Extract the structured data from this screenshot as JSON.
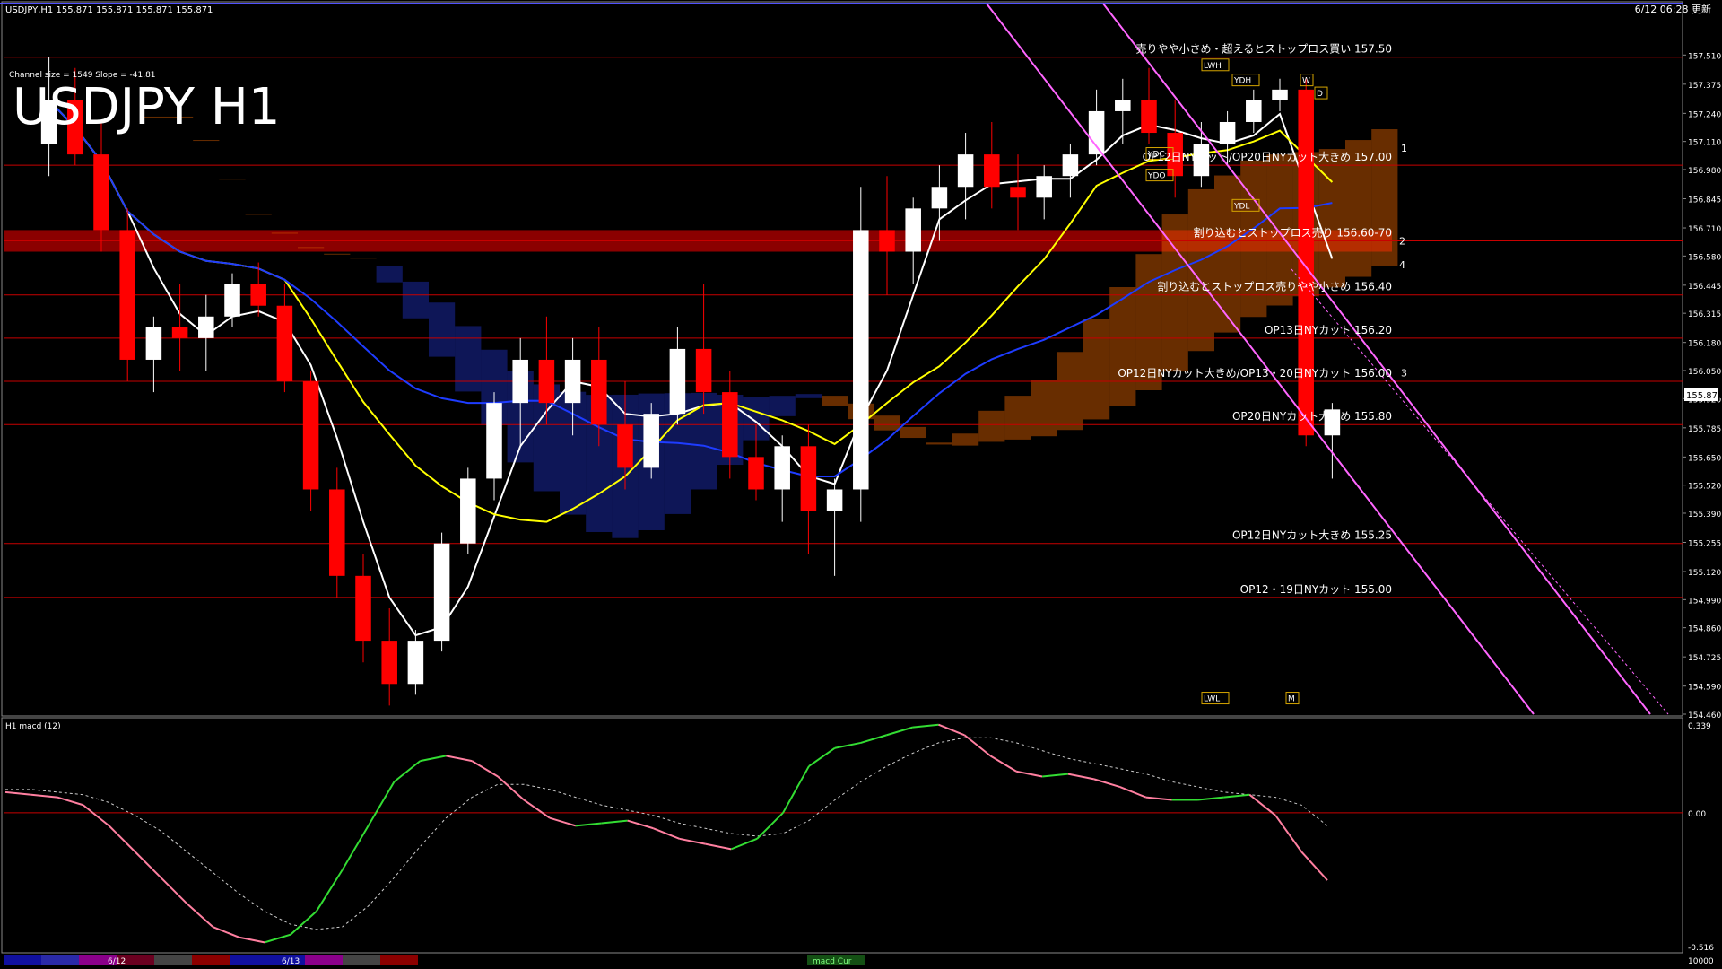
{
  "window": {
    "symbol_info": "USDJPY,H1  155.871 155.871 155.871 155.871",
    "timestamp": "6/12 06:28 更新",
    "channel_info": "Channel size = 1549 Slope = -41.81",
    "big_title": "USDJPY H1",
    "price_label": "155.871"
  },
  "colors": {
    "background": "#000000",
    "bull_candle": "#ffffff",
    "bear_candle": "#ff0000",
    "level_line": "#c80000",
    "resistance_band": "#8b0000",
    "macd_line": "#ff7fa0",
    "macd_up": "#33dd33",
    "macd_signal": "#cccccc",
    "ma_white": "#ffffff",
    "ma_yellow": "#ffff00",
    "ma_blue": "#1e3cff",
    "channel_line": "#ff66ff",
    "cloud": "#e66400"
  },
  "chart_data": [
    {
      "type": "candlestick",
      "title": "USDJPY H1",
      "ylim": [
        154.46,
        157.64
      ],
      "yticks": [
        "157.510",
        "157.375",
        "157.240",
        "157.110",
        "156.980",
        "156.845",
        "156.710",
        "156.580",
        "156.445",
        "156.315",
        "156.180",
        "156.050",
        "155.920",
        "155.785",
        "155.650",
        "155.520",
        "155.390",
        "155.255",
        "155.120",
        "154.990",
        "154.860",
        "154.725",
        "154.590",
        "154.460"
      ],
      "current_price": 155.871,
      "levels": [
        {
          "price": 157.5,
          "label": "売りやや小さめ・超えるとストップロス買い 157.50"
        },
        {
          "price": 157.0,
          "label": "OP12日NYカット/OP20日NYカット大きめ 157.00"
        },
        {
          "price": 156.65,
          "label": "割り込むとストップロス売り 156.60-70"
        },
        {
          "price": 156.4,
          "label": "割り込むとストップロス売りやや小さめ 156.40"
        },
        {
          "price": 156.2,
          "label": "OP13日NYカット 156.20"
        },
        {
          "price": 156.0,
          "label": "OP12日NYカット大きめ/OP13・20日NYカット 156.00"
        },
        {
          "price": 155.8,
          "label": "OP20日NYカット大きめ 155.80"
        },
        {
          "price": 155.25,
          "label": "OP12日NYカット大きめ 155.25"
        },
        {
          "price": 155.0,
          "label": "OP12・19日NYカット 155.00"
        }
      ],
      "channel_numbers": [
        "1",
        "2",
        "3",
        "4"
      ],
      "markers": [
        "LWH",
        "YDH",
        "YDL",
        "YDC",
        "YDO",
        "W",
        "D",
        "LWL",
        "M"
      ],
      "candles": [
        {
          "o": 157.1,
          "h": 157.5,
          "l": 156.95,
          "c": 157.3
        },
        {
          "o": 157.3,
          "h": 157.45,
          "l": 157.0,
          "c": 157.05
        },
        {
          "o": 157.05,
          "h": 157.2,
          "l": 156.6,
          "c": 156.7
        },
        {
          "o": 156.7,
          "h": 156.8,
          "l": 156.0,
          "c": 156.1
        },
        {
          "o": 156.1,
          "h": 156.3,
          "l": 155.95,
          "c": 156.25
        },
        {
          "o": 156.25,
          "h": 156.45,
          "l": 156.05,
          "c": 156.2
        },
        {
          "o": 156.2,
          "h": 156.4,
          "l": 156.05,
          "c": 156.3
        },
        {
          "o": 156.3,
          "h": 156.5,
          "l": 156.25,
          "c": 156.45
        },
        {
          "o": 156.45,
          "h": 156.55,
          "l": 156.3,
          "c": 156.35
        },
        {
          "o": 156.35,
          "h": 156.45,
          "l": 155.95,
          "c": 156.0
        },
        {
          "o": 156.0,
          "h": 156.05,
          "l": 155.4,
          "c": 155.5
        },
        {
          "o": 155.5,
          "h": 155.6,
          "l": 155.0,
          "c": 155.1
        },
        {
          "o": 155.1,
          "h": 155.2,
          "l": 154.7,
          "c": 154.8
        },
        {
          "o": 154.8,
          "h": 154.95,
          "l": 154.5,
          "c": 154.6
        },
        {
          "o": 154.6,
          "h": 154.85,
          "l": 154.55,
          "c": 154.8
        },
        {
          "o": 154.8,
          "h": 155.3,
          "l": 154.75,
          "c": 155.25
        },
        {
          "o": 155.25,
          "h": 155.6,
          "l": 155.2,
          "c": 155.55
        },
        {
          "o": 155.55,
          "h": 155.95,
          "l": 155.45,
          "c": 155.9
        },
        {
          "o": 155.9,
          "h": 156.2,
          "l": 155.7,
          "c": 156.1
        },
        {
          "o": 156.1,
          "h": 156.3,
          "l": 155.8,
          "c": 155.9
        },
        {
          "o": 155.9,
          "h": 156.2,
          "l": 155.75,
          "c": 156.1
        },
        {
          "o": 156.1,
          "h": 156.25,
          "l": 155.7,
          "c": 155.8
        },
        {
          "o": 155.8,
          "h": 156.0,
          "l": 155.5,
          "c": 155.6
        },
        {
          "o": 155.6,
          "h": 155.9,
          "l": 155.55,
          "c": 155.85
        },
        {
          "o": 155.85,
          "h": 156.25,
          "l": 155.8,
          "c": 156.15
        },
        {
          "o": 156.15,
          "h": 156.45,
          "l": 155.85,
          "c": 155.95
        },
        {
          "o": 155.95,
          "h": 156.05,
          "l": 155.55,
          "c": 155.65
        },
        {
          "o": 155.65,
          "h": 155.8,
          "l": 155.45,
          "c": 155.5
        },
        {
          "o": 155.5,
          "h": 155.75,
          "l": 155.35,
          "c": 155.7
        },
        {
          "o": 155.7,
          "h": 155.8,
          "l": 155.2,
          "c": 155.4
        },
        {
          "o": 155.4,
          "h": 155.55,
          "l": 155.1,
          "c": 155.5
        },
        {
          "o": 155.5,
          "h": 156.9,
          "l": 155.35,
          "c": 156.7
        },
        {
          "o": 156.7,
          "h": 156.95,
          "l": 156.4,
          "c": 156.6
        },
        {
          "o": 156.6,
          "h": 156.85,
          "l": 156.45,
          "c": 156.8
        },
        {
          "o": 156.8,
          "h": 157.0,
          "l": 156.65,
          "c": 156.9
        },
        {
          "o": 156.9,
          "h": 157.15,
          "l": 156.75,
          "c": 157.05
        },
        {
          "o": 157.05,
          "h": 157.2,
          "l": 156.8,
          "c": 156.9
        },
        {
          "o": 156.9,
          "h": 157.05,
          "l": 156.7,
          "c": 156.85
        },
        {
          "o": 156.85,
          "h": 157.0,
          "l": 156.75,
          "c": 156.95
        },
        {
          "o": 156.95,
          "h": 157.1,
          "l": 156.85,
          "c": 157.05
        },
        {
          "o": 157.05,
          "h": 157.35,
          "l": 157.0,
          "c": 157.25
        },
        {
          "o": 157.25,
          "h": 157.4,
          "l": 157.1,
          "c": 157.3
        },
        {
          "o": 157.3,
          "h": 157.45,
          "l": 157.1,
          "c": 157.15
        },
        {
          "o": 157.15,
          "h": 157.3,
          "l": 156.85,
          "c": 156.95
        },
        {
          "o": 156.95,
          "h": 157.2,
          "l": 156.9,
          "c": 157.1
        },
        {
          "o": 157.1,
          "h": 157.25,
          "l": 157.0,
          "c": 157.2
        },
        {
          "o": 157.2,
          "h": 157.35,
          "l": 157.15,
          "c": 157.3
        },
        {
          "o": 157.3,
          "h": 157.4,
          "l": 157.25,
          "c": 157.35
        },
        {
          "o": 157.35,
          "h": 157.4,
          "l": 155.7,
          "c": 155.75
        },
        {
          "o": 155.75,
          "h": 155.9,
          "l": 155.55,
          "c": 155.87
        }
      ]
    },
    {
      "type": "line",
      "title": "H1 macd (12)",
      "ylim": [
        -0.516,
        0.339
      ],
      "yticks": [
        "0.339",
        "0.00",
        "-0.516"
      ],
      "series": [
        {
          "values": [
            0.08,
            0.07,
            0.06,
            0.03,
            -0.05,
            -0.15,
            -0.25,
            -0.35,
            -0.44,
            -0.48,
            -0.5,
            -0.47,
            -0.38,
            -0.22,
            -0.05,
            0.12,
            0.2,
            0.22,
            0.2,
            0.14,
            0.05,
            -0.02,
            -0.05,
            -0.04,
            -0.03,
            -0.06,
            -0.1,
            -0.12,
            -0.14,
            -0.1,
            0.0,
            0.18,
            0.25,
            0.27,
            0.3,
            0.33,
            0.34,
            0.3,
            0.22,
            0.16,
            0.14,
            0.15,
            0.13,
            0.1,
            0.06,
            0.05,
            0.05,
            0.06,
            0.07,
            -0.01,
            -0.15,
            -0.26
          ]
        },
        {
          "values": [
            0.09,
            0.09,
            0.08,
            0.07,
            0.04,
            -0.01,
            -0.07,
            -0.15,
            -0.23,
            -0.31,
            -0.38,
            -0.43,
            -0.45,
            -0.44,
            -0.36,
            -0.25,
            -0.13,
            -0.02,
            0.06,
            0.11,
            0.11,
            0.09,
            0.06,
            0.03,
            0.01,
            -0.01,
            -0.04,
            -0.06,
            -0.08,
            -0.09,
            -0.08,
            -0.03,
            0.05,
            0.12,
            0.18,
            0.23,
            0.27,
            0.29,
            0.29,
            0.27,
            0.24,
            0.21,
            0.19,
            0.17,
            0.15,
            0.12,
            0.1,
            0.08,
            0.07,
            0.06,
            0.03,
            -0.05
          ]
        }
      ]
    }
  ],
  "footer": {
    "dates": [
      "6/12",
      "6/13"
    ],
    "macd_tag": "macd Cur",
    "right_value": "10000"
  }
}
